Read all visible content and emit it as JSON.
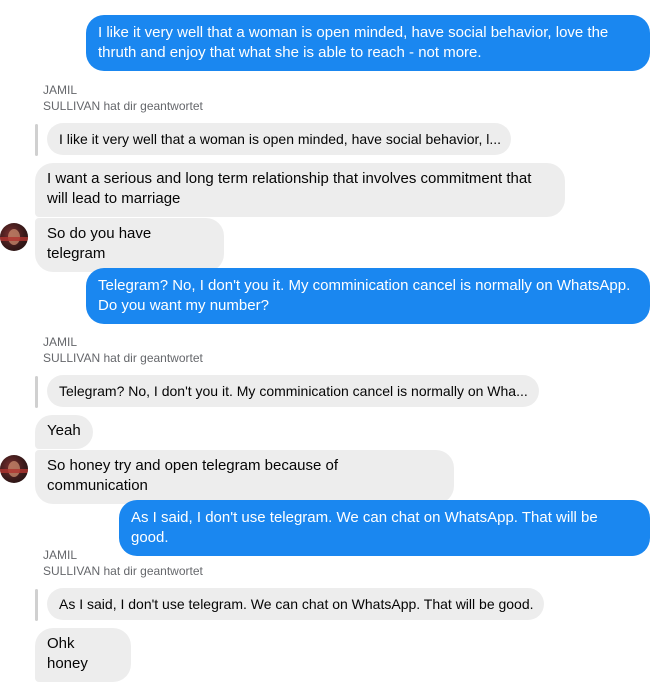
{
  "messages": {
    "m1": "I like it very well that a woman is open minded, have social behavior, love the thruth and enjoy that what she is able to reach - not more.",
    "r1_name": "JAMIL",
    "r1_text": "SULLIVAN hat dir geantwortet",
    "q1": "I like it very well that a woman is open minded, have social behavior, l...",
    "m2": "I want a serious and long term relationship that involves commitment that will lead to marriage",
    "m3": "So do you have telegram",
    "m4": "Telegram? No, I don't you it. My comminication cancel is normally on WhatsApp. Do you want my number?",
    "r2_name": "JAMIL",
    "r2_text": "SULLIVAN hat dir geantwortet",
    "q2": "Telegram? No, I don't you it. My comminication cancel is normally on Wha...",
    "m5": "Yeah",
    "m6": "So honey try and open telegram because of communication",
    "m7": "As I said, I don't use telegram. We can chat on WhatsApp. That will be good.",
    "r3_name": "JAMIL",
    "r3_text": "SULLIVAN hat dir geantwortet",
    "q3": "As I said, I don't use telegram. We can chat on WhatsApp. That will be good.",
    "m8": "Ohk honey"
  },
  "colors": {
    "outgoing": "#1a87f0",
    "incoming": "#ededed"
  }
}
